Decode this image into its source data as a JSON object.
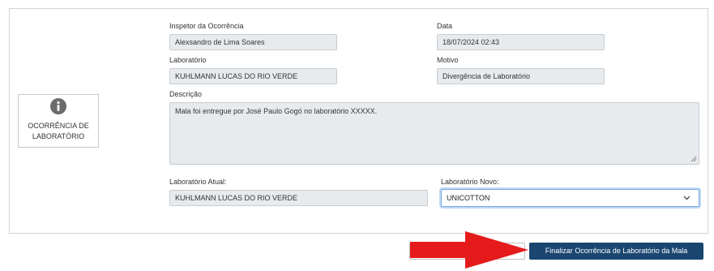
{
  "badge": {
    "label": "OCORRÊNCIA DE LABORATÓRIO",
    "icon": "info-circle-icon"
  },
  "fields": {
    "inspector": {
      "label": "Inspetor da Ocorrência",
      "value": "Alexsandro de Lima Soares"
    },
    "date": {
      "label": "Data",
      "value": "18/07/2024 02:43"
    },
    "laboratory": {
      "label": "Laboratório",
      "value": "KUHLMANN LUCAS DO RIO VERDE"
    },
    "reason": {
      "label": "Motivo",
      "value": "Divergência de Laboratório"
    },
    "description": {
      "label": "Descrição",
      "value": "Mala foi entregue por José Paulo Gogó no laboratório XXXXX."
    },
    "current_lab": {
      "label": "Laboratório Atual:",
      "value": "KUHLMANN LUCAS DO RIO VERDE"
    },
    "new_lab": {
      "label": "Laboratório Novo:",
      "value": "UNICOTTON"
    }
  },
  "buttons": {
    "finalize": "Finalizar Ocorrência de Laboratório da Mala"
  },
  "colors": {
    "primary_button": "#1a4670",
    "arrow": "#e51b1b",
    "readonly_field": "#e8ebee"
  }
}
